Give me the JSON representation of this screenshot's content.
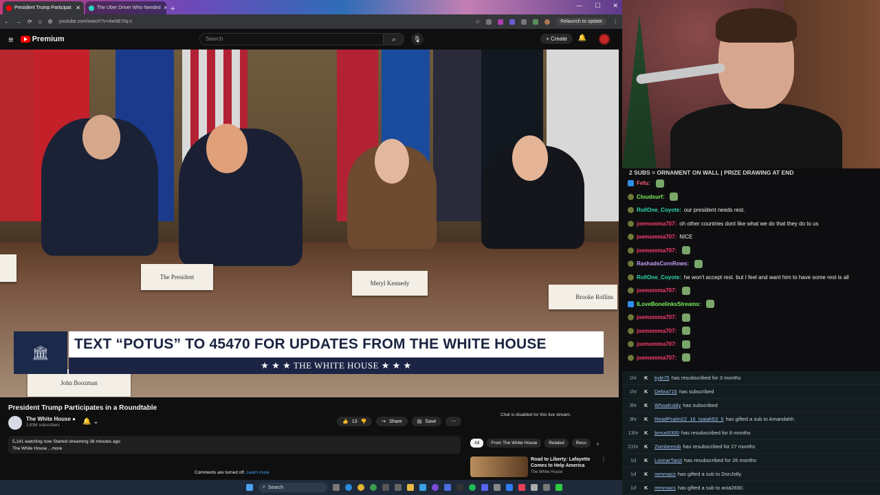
{
  "browser": {
    "tabs": [
      {
        "label": "President Trump Participat",
        "active": true
      },
      {
        "label": "The Uber Driver Who Needed",
        "active": false
      }
    ],
    "url": "youtube.com/watch?v=rlwhB70q-c",
    "relaunch_label": "Relaunch to update"
  },
  "youtube": {
    "logo_text": "Premium",
    "search_placeholder": "Search",
    "create_label": "Create"
  },
  "video": {
    "placard_president": "The President",
    "placard_kennedy": "Meryl Kennedy",
    "placard_rollins": "Brooke Rollins",
    "placard_boozman": "John Boozman",
    "lower_third_text": "TEXT “POTUS” TO 45470 FOR UPDATES FROM THE WHITE HOUSE",
    "lower_third_bar": "★ ★ ★   THE WHITE HOUSE   ★ ★ ★"
  },
  "watch": {
    "title": "President Trump Participates in a Roundtable",
    "channel": "The White House",
    "subscribers": "2.83M subscribers",
    "like_count": "13",
    "share_label": "Share",
    "save_label": "Save",
    "desc_line1": "5,141 watching now  Started streaming 36 minutes ago",
    "desc_line2": "The White House ...more",
    "comments_off": "Comments are turned off.",
    "learn_more": "Learn more",
    "chat_disabled": "Chat is disabled for this live stream.",
    "chips": [
      "All",
      "From The White House",
      "Related",
      "Reco"
    ],
    "reco_title": "Road to Liberty: Lafayette Comes to Help America",
    "reco_channel": "The White House"
  },
  "taskbar": {
    "search_label": "Search"
  },
  "stream": {
    "banner": "2 SUBS = ORNAMENT ON WALL | PRIZE DRAWING AT END",
    "chat": [
      {
        "user": "Fefu:",
        "color": "#ff5e7a",
        "text": "",
        "emote": true
      },
      {
        "user": "Cloudsurf:",
        "color": "#7cf25f",
        "text": "",
        "emote": true
      },
      {
        "user": "RollOne_Coyote:",
        "color": "#2fd8b0",
        "text": "our president needs rest.",
        "emote": false
      },
      {
        "user": "joemomma707:",
        "color": "#ff3c6e",
        "text": "oh other countries dont like what we do that they do to us",
        "emote": false
      },
      {
        "user": "joemomma707:",
        "color": "#ff3c6e",
        "text": "NICE",
        "emote": false
      },
      {
        "user": "joemomma707:",
        "color": "#ff3c6e",
        "text": "",
        "emote": true
      },
      {
        "user": "RashadsCornRows:",
        "color": "#c7a0ff",
        "text": "",
        "emote": true
      },
      {
        "user": "RollOne_Coyote:",
        "color": "#2fd8b0",
        "text": "he won't accept rest. but I feel and want him to have some rest is all",
        "emote": false
      },
      {
        "user": "joemomma707:",
        "color": "#ff3c6e",
        "text": "",
        "emote": true
      },
      {
        "user": "ILoveBonelinksStreams:",
        "color": "#7cf25f",
        "text": "",
        "emote": true
      },
      {
        "user": "joemomma707:",
        "color": "#ff3c6e",
        "text": "",
        "emote": true
      },
      {
        "user": "joemomma707:",
        "color": "#ff3c6e",
        "text": "",
        "emote": true
      },
      {
        "user": "joemomma707:",
        "color": "#ff3c6e",
        "text": "",
        "emote": true
      },
      {
        "user": "joemomma707:",
        "color": "#ff3c6e",
        "text": "",
        "emote": true
      }
    ],
    "events": [
      {
        "time": "1hr",
        "user": "kyle75",
        "text": "has resubscribed for 3 months"
      },
      {
        "time": "1hr",
        "user": "Debra715",
        "text": "has subscribed"
      },
      {
        "time": "3hr",
        "user": "WhoaKoldy",
        "text": "has subscribed"
      },
      {
        "time": "3hr",
        "user": "ReadPsalm22_16_Isaiah53_5",
        "text": "has gifted a sub to Amandahh."
      },
      {
        "time": "13hr",
        "user": "brnuo5300",
        "text": "has resubscribed for 8 months"
      },
      {
        "time": "21hr",
        "user": "Zombeerob",
        "text": "has resubscribed for 27 months"
      },
      {
        "time": "1d",
        "user": "LoonarTarot",
        "text": "has resubscribed for 26 months"
      },
      {
        "time": "1d",
        "user": "remmacs",
        "text": "has gifted a sub to DonJolly."
      },
      {
        "time": "1d",
        "user": "remmacs",
        "text": "has gifted a sub to ania2830."
      }
    ]
  }
}
